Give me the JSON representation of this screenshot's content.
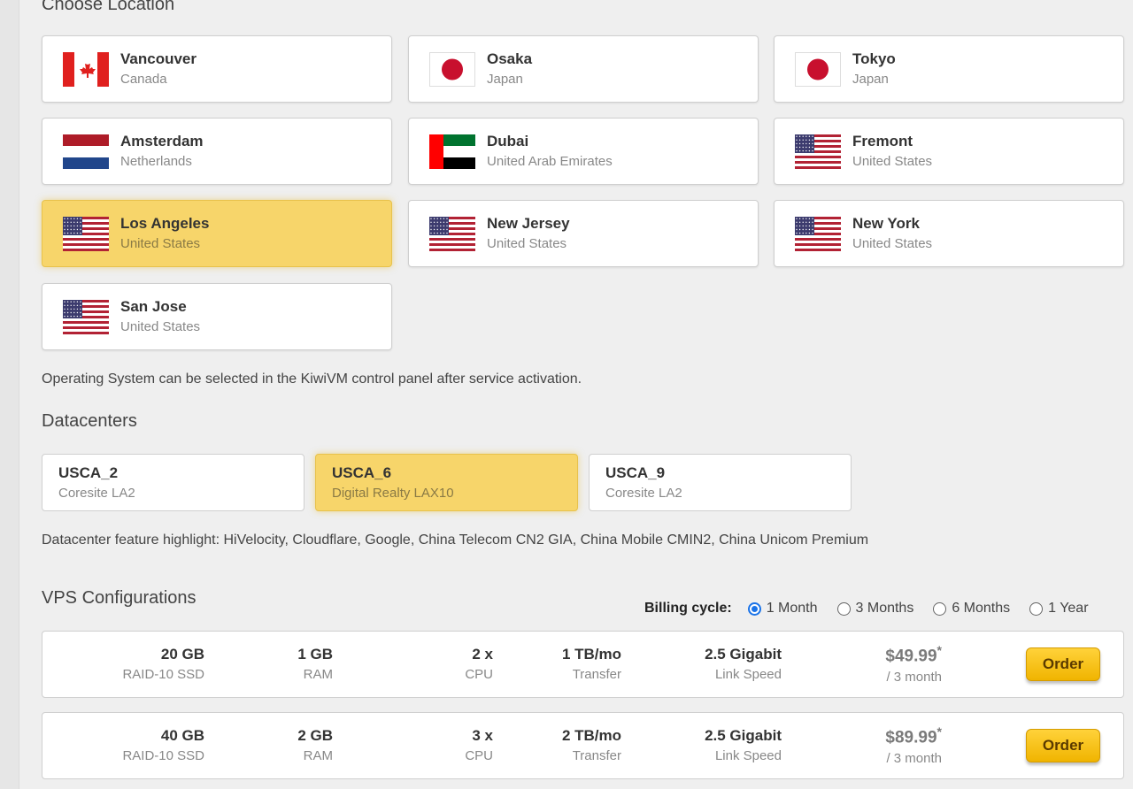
{
  "location": {
    "title": "Choose Location",
    "cards": [
      {
        "city": "Vancouver",
        "country": "Canada",
        "flag": "canada-flag-icon"
      },
      {
        "city": "Osaka",
        "country": "Japan",
        "flag": "japan-flag-icon"
      },
      {
        "city": "Tokyo",
        "country": "Japan",
        "flag": "japan-flag-icon"
      },
      {
        "city": "Amsterdam",
        "country": "Netherlands",
        "flag": "netherlands-flag-icon"
      },
      {
        "city": "Dubai",
        "country": "United Arab Emirates",
        "flag": "uae-flag-icon"
      },
      {
        "city": "Fremont",
        "country": "United States",
        "flag": "usa-flag-icon"
      },
      {
        "city": "Los Angeles",
        "country": "United States",
        "flag": "usa-flag-icon",
        "selected": true
      },
      {
        "city": "New Jersey",
        "country": "United States",
        "flag": "usa-flag-icon"
      },
      {
        "city": "New York",
        "country": "United States",
        "flag": "usa-flag-icon"
      },
      {
        "city": "San Jose",
        "country": "United States",
        "flag": "usa-flag-icon"
      }
    ],
    "os_note": "Operating System can be selected in the KiwiVM control panel after service activation."
  },
  "datacenters": {
    "title": "Datacenters",
    "cards": [
      {
        "code": "USCA_2",
        "name": "Coresite LA2"
      },
      {
        "code": "USCA_6",
        "name": "Digital Realty LAX10",
        "selected": true
      },
      {
        "code": "USCA_9",
        "name": "Coresite LA2"
      }
    ],
    "feature_note": "Datacenter feature highlight: HiVelocity, Cloudflare, Google, China Telecom CN2 GIA, China Mobile CMIN2, China Unicom Premium"
  },
  "vps": {
    "title": "VPS Configurations",
    "billing_label": "Billing cycle:",
    "billing_options": [
      "1 Month",
      "3 Months",
      "6 Months",
      "1 Year"
    ],
    "billing_selected": "1 Month",
    "plans": [
      {
        "disk": "20 GB",
        "disk_label": "RAID-10 SSD",
        "ram": "1 GB",
        "ram_label": "RAM",
        "cpu": "2 x",
        "cpu_label": "CPU",
        "transfer": "1 TB/mo",
        "transfer_label": "Transfer",
        "speed": "2.5 Gigabit",
        "speed_label": "Link Speed",
        "price": "$49.99",
        "price_mark": "*",
        "period": "/ 3 month",
        "order_label": "Order"
      },
      {
        "disk": "40 GB",
        "disk_label": "RAID-10 SSD",
        "ram": "2 GB",
        "ram_label": "RAM",
        "cpu": "3 x",
        "cpu_label": "CPU",
        "transfer": "2 TB/mo",
        "transfer_label": "Transfer",
        "speed": "2.5 Gigabit",
        "speed_label": "Link Speed",
        "price": "$89.99",
        "price_mark": "*",
        "period": "/ 3 month",
        "order_label": "Order"
      }
    ]
  },
  "colors": {
    "selected_bg": "#f7d56a",
    "order_button": "#f0b400",
    "radio_checked": "#1a73e8"
  }
}
